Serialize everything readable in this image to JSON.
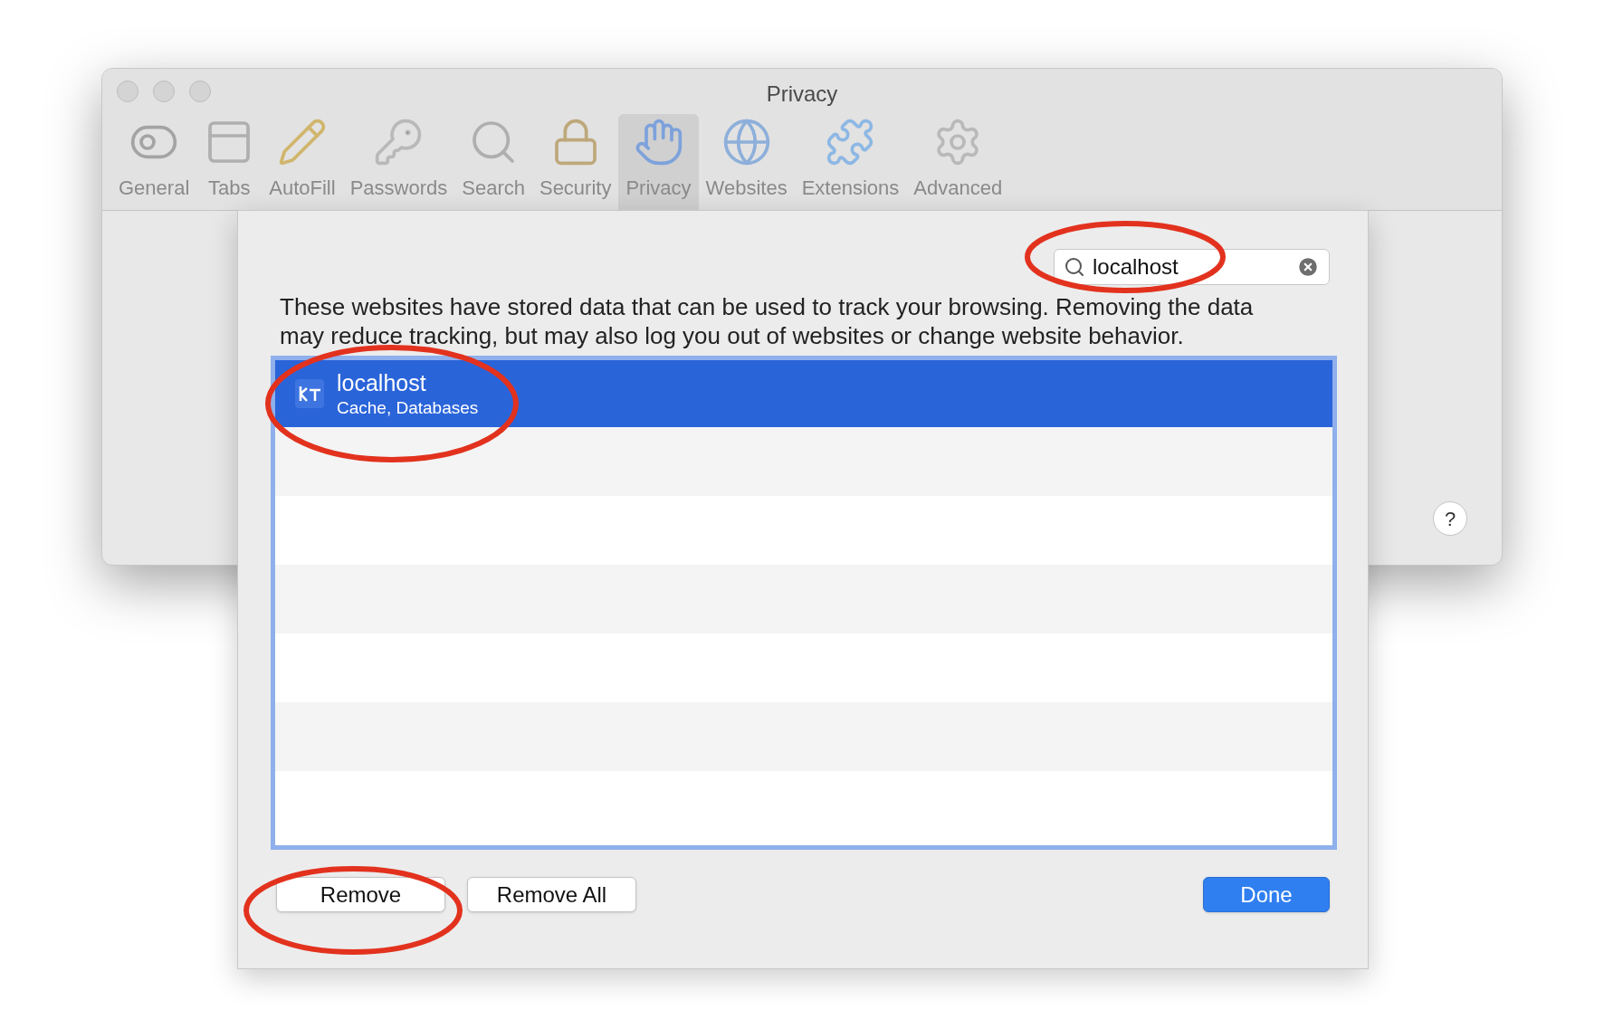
{
  "window": {
    "title": "Privacy"
  },
  "toolbar": [
    {
      "label": "General",
      "selected": false
    },
    {
      "label": "Tabs",
      "selected": false
    },
    {
      "label": "AutoFill",
      "selected": false
    },
    {
      "label": "Passwords",
      "selected": false
    },
    {
      "label": "Search",
      "selected": false
    },
    {
      "label": "Security",
      "selected": false
    },
    {
      "label": "Privacy",
      "selected": true
    },
    {
      "label": "Websites",
      "selected": false
    },
    {
      "label": "Extensions",
      "selected": false
    },
    {
      "label": "Advanced",
      "selected": false
    }
  ],
  "sheet": {
    "search": {
      "value": "localhost"
    },
    "description": "These websites have stored data that can be used to track your browsing. Removing the data may reduce tracking, but may also log you out of websites or change website behavior.",
    "sites": [
      {
        "name": "localhost",
        "details": "Cache, Databases",
        "selected": true
      }
    ],
    "buttons": [
      {
        "label": "Remove",
        "kind": "default"
      },
      {
        "label": "Remove All",
        "kind": "default"
      },
      {
        "label": "Done",
        "kind": "primary"
      }
    ]
  },
  "help": "?",
  "annotations": [
    {
      "kind": "circle"
    },
    {
      "kind": "circle"
    },
    {
      "kind": "circle"
    }
  ]
}
